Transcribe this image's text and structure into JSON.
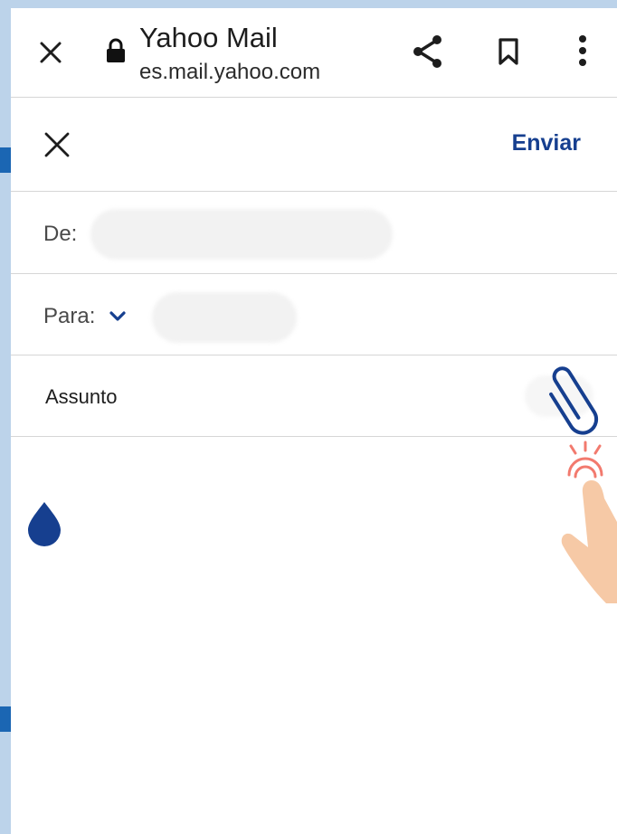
{
  "browser": {
    "title": "Yahoo Mail",
    "host": "es.mail.yahoo.com",
    "icons": [
      "close-icon",
      "lock-icon",
      "share-icon",
      "bookmark-icon",
      "more-vertical-icon"
    ]
  },
  "compose": {
    "close_icon": "close-icon",
    "send_label": "Enviar",
    "from_label": "De:",
    "to_label": "Para:",
    "subject_placeholder": "Assunto",
    "attach_icon": "paperclip-icon",
    "cursor_icon": "text-cursor-handle-icon"
  },
  "overlay": {
    "tap_hint_icon": "tapping-finger-icon"
  },
  "colors": {
    "accent": "#163f8f",
    "frame": "#bcd3ea",
    "tap_hint": "#f27a6e"
  }
}
